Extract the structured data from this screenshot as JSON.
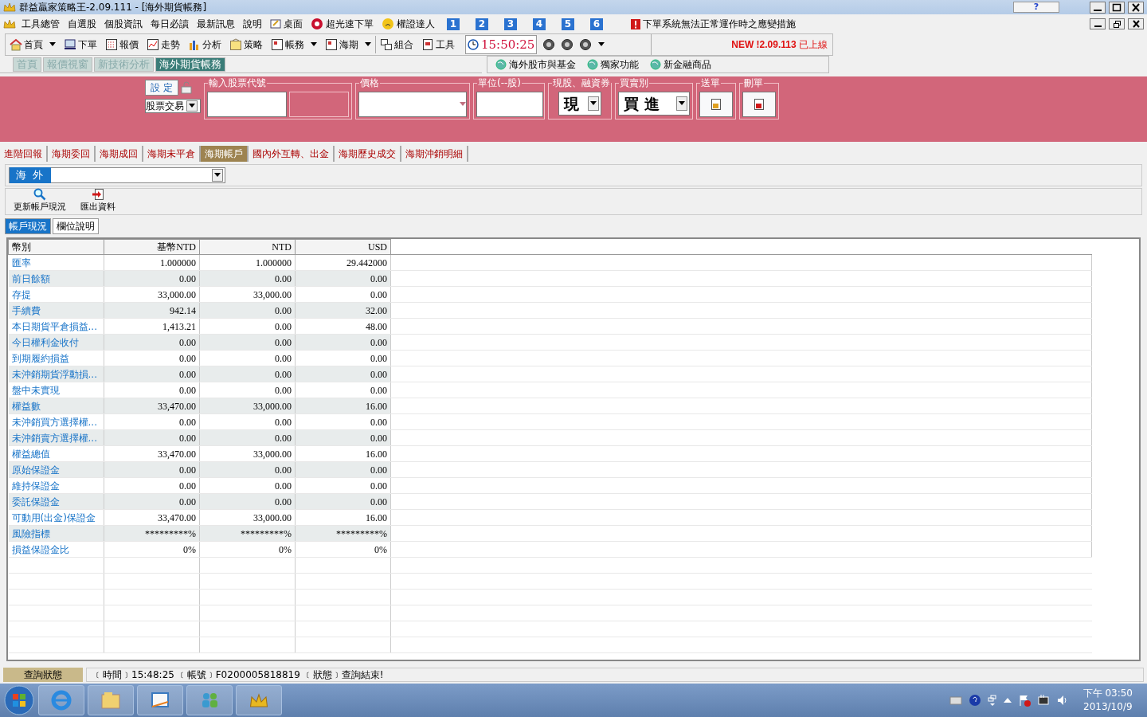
{
  "window": {
    "title": "群益贏家策略王-2.09.111 - [海外期貨帳務]",
    "help": "?"
  },
  "menu": [
    {
      "kind": "text",
      "label": "工具總管"
    },
    {
      "kind": "text",
      "label": "自選股"
    },
    {
      "kind": "text",
      "label": "個股資訊"
    },
    {
      "kind": "text",
      "label": "每日必讀"
    },
    {
      "kind": "text",
      "label": "最新訊息"
    },
    {
      "kind": "text",
      "label": "說明"
    },
    {
      "kind": "desktop",
      "label": "桌面"
    },
    {
      "kind": "order",
      "label": "超光速下單"
    },
    {
      "kind": "warrant",
      "label": "權證達人"
    },
    {
      "kind": "number",
      "label": "1"
    },
    {
      "kind": "number",
      "label": "2"
    },
    {
      "kind": "number",
      "label": "3"
    },
    {
      "kind": "number",
      "label": "4"
    },
    {
      "kind": "number",
      "label": "5"
    },
    {
      "kind": "number",
      "label": "6"
    },
    {
      "kind": "alert",
      "label": "下單系統無法正常運作時之應變措施"
    }
  ],
  "toolbar": [
    {
      "label": "首頁",
      "dropdown": true
    },
    {
      "label": "下單",
      "dropdown": false
    },
    {
      "label": "報價",
      "dropdown": false
    },
    {
      "label": "走勢",
      "dropdown": false
    },
    {
      "label": "分析",
      "dropdown": false
    },
    {
      "label": "策略",
      "dropdown": false
    },
    {
      "label": "帳務",
      "dropdown": true
    },
    {
      "label": "海期",
      "dropdown": true
    },
    {
      "label": "組合",
      "dropdown": false
    },
    {
      "label": "工具",
      "dropdown": false
    }
  ],
  "clock": "15:50:25",
  "notice": {
    "new": "NEW !2.09.113",
    "text": "已上線"
  },
  "page_tabs": [
    {
      "label": "首頁",
      "selected": false
    },
    {
      "label": "報價視窗",
      "selected": false
    },
    {
      "label": "新技術分析",
      "selected": false
    },
    {
      "label": "海外期貨帳務",
      "selected": true
    }
  ],
  "links": [
    "海外股市與基金",
    "獨家功能",
    "新金融商品"
  ],
  "order_panel": {
    "settings_button": "設 定",
    "trade_type": "股票交易",
    "code_label": "輸入股票代號",
    "price_label": "價格",
    "unit_label": "單位(--股)",
    "cash_label": "現股、融資券",
    "cash_value": "現",
    "side_label": "買賣別",
    "side_value": "買 進",
    "send_label": "送單",
    "delete_label": "刪單"
  },
  "function_tabs": [
    {
      "label": "進階回報",
      "selected": false
    },
    {
      "label": "海期委回",
      "selected": false
    },
    {
      "label": "海期成回",
      "selected": false
    },
    {
      "label": "海期未平倉",
      "selected": false
    },
    {
      "label": "海期帳戶",
      "selected": true
    },
    {
      "label": "國內外互轉、出金",
      "selected": false
    },
    {
      "label": "海期歷史成交",
      "selected": false
    },
    {
      "label": "海期沖銷明細",
      "selected": false
    }
  ],
  "account": {
    "value": "海 外"
  },
  "actions": [
    {
      "kind": "refresh",
      "label": "更新帳戶現況"
    },
    {
      "kind": "export",
      "label": "匯出資料"
    }
  ],
  "sub_tabs": [
    {
      "label": "帳戶現況",
      "selected": true
    },
    {
      "label": "欄位說明",
      "selected": false
    }
  ],
  "table": {
    "columns": [
      "幣別",
      "基幣NTD",
      "NTD",
      "USD"
    ],
    "rows": [
      [
        "匯率",
        "1.000000",
        "1.000000",
        "29.442000"
      ],
      [
        "前日餘額",
        "0.00",
        "0.00",
        "0.00"
      ],
      [
        "存提",
        "33,000.00",
        "33,000.00",
        "0.00"
      ],
      [
        "手續費",
        "942.14",
        "0.00",
        "32.00"
      ],
      [
        "本日期貨平倉損益...",
        "1,413.21",
        "0.00",
        "48.00"
      ],
      [
        "今日權利金收付",
        "0.00",
        "0.00",
        "0.00"
      ],
      [
        "到期履約損益",
        "0.00",
        "0.00",
        "0.00"
      ],
      [
        "未沖銷期貨浮動損...",
        "0.00",
        "0.00",
        "0.00"
      ],
      [
        "盤中未實現",
        "0.00",
        "0.00",
        "0.00"
      ],
      [
        "權益數",
        "33,470.00",
        "33,000.00",
        "16.00"
      ],
      [
        "未沖銷買方選擇權...",
        "0.00",
        "0.00",
        "0.00"
      ],
      [
        "未沖銷賣方選擇權...",
        "0.00",
        "0.00",
        "0.00"
      ],
      [
        "權益總值",
        "33,470.00",
        "33,000.00",
        "16.00"
      ],
      [
        "原始保證金",
        "0.00",
        "0.00",
        "0.00"
      ],
      [
        "維持保證金",
        "0.00",
        "0.00",
        "0.00"
      ],
      [
        "委託保證金",
        "0.00",
        "0.00",
        "0.00"
      ],
      [
        "可動用(出金)保證金",
        "33,470.00",
        "33,000.00",
        "16.00"
      ],
      [
        "風險指標",
        "*********%",
        "*********%",
        "*********%"
      ],
      [
        "損益保證金比",
        "0%",
        "0%",
        "0%"
      ]
    ]
  },
  "status": {
    "label": "查詢狀態",
    "text": "﹝時間﹞15:48:25 ﹝帳號﹞F0200005818819 ﹝狀態﹞查詢結束!"
  },
  "taskbar": {
    "time": "下午 03:50",
    "date": "2013/10/9"
  }
}
